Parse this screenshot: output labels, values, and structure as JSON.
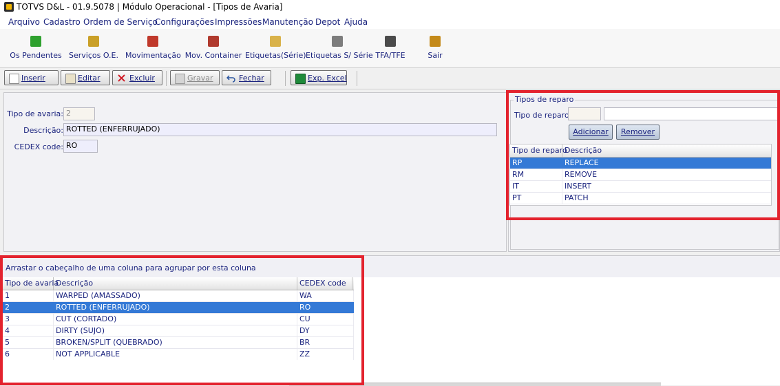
{
  "window": {
    "title": "TOTVS D&L - 01.9.5078 | Módulo Operacional - [Tipos de Avaria]"
  },
  "menu": [
    "Arquivo",
    "Cadastro",
    "Ordem de Serviço",
    "Configurações",
    "Impressões",
    "Manutenção",
    "Depot",
    "Ajuda"
  ],
  "toolbar": [
    {
      "label": "Os Pendentes",
      "icon": "check-icon",
      "color": "#2fa12f"
    },
    {
      "label": "Serviços O.E.",
      "icon": "truck-icon",
      "color": "#caa028"
    },
    {
      "label": "Movimentação",
      "icon": "crane-icon",
      "color": "#c0392b"
    },
    {
      "label": "Mov. Container",
      "icon": "container-icon",
      "color": "#b03a2e"
    },
    {
      "label": "Etiquetas(Série)",
      "icon": "label-icon",
      "color": "#d9b24a"
    },
    {
      "label": "Etiquetas S/ Série",
      "icon": "printer-icon",
      "color": "#7d7d7d"
    },
    {
      "label": "TFA/TFE",
      "icon": "gears-icon",
      "color": "#4b4b4b"
    },
    {
      "label": "Sair",
      "icon": "exit-door-icon",
      "color": "#c48a1a"
    }
  ],
  "actions": {
    "inserir": "Inserir",
    "editar": "Editar",
    "excluir": "Excluir",
    "gravar": "Gravar",
    "fechar": "Fechar",
    "export_excel": "Exp. Excel"
  },
  "form": {
    "tipo_label": "Tipo de avaria:",
    "tipo_value": "2",
    "descricao_label": "Descrição:",
    "descricao_value": "ROTTED (ENFERRUJADO)",
    "cedex_label": "CEDEX code:",
    "cedex_value": "RO"
  },
  "reparo": {
    "group_title": "Tipos de reparo",
    "field_label": "Tipo de reparo:",
    "field_value": "",
    "field_desc_value": "",
    "add_label": "Adicionar",
    "remove_label": "Remover",
    "columns": [
      "Tipo de reparo",
      "Descrição"
    ],
    "rows": [
      {
        "code": "RP",
        "desc": "REPLACE"
      },
      {
        "code": "RM",
        "desc": "REMOVE"
      },
      {
        "code": "IT",
        "desc": "INSERT"
      },
      {
        "code": "PT",
        "desc": "PATCH"
      }
    ],
    "selected_index": 0
  },
  "avarias": {
    "group_hint": "Arrastar o cabeçalho de uma coluna para agrupar por esta coluna",
    "columns": [
      "Tipo de avaria",
      "Descrição",
      "CEDEX code"
    ],
    "rows": [
      {
        "tipo": "1",
        "desc": "WARPED (AMASSADO)",
        "cedex": "WA"
      },
      {
        "tipo": "2",
        "desc": "ROTTED (ENFERRUJADO)",
        "cedex": "RO"
      },
      {
        "tipo": "3",
        "desc": "CUT (CORTADO)",
        "cedex": "CU"
      },
      {
        "tipo": "4",
        "desc": "DIRTY (SUJO)",
        "cedex": "DY"
      },
      {
        "tipo": "5",
        "desc": "BROKEN/SPLIT (QUEBRADO)",
        "cedex": "BR"
      },
      {
        "tipo": "6",
        "desc": "NOT APPLICABLE",
        "cedex": "ZZ"
      }
    ],
    "selected_index": 1
  },
  "colors": {
    "accent": "#3479d6",
    "highlight_box": "#e3232e",
    "text": "#1a237e"
  }
}
